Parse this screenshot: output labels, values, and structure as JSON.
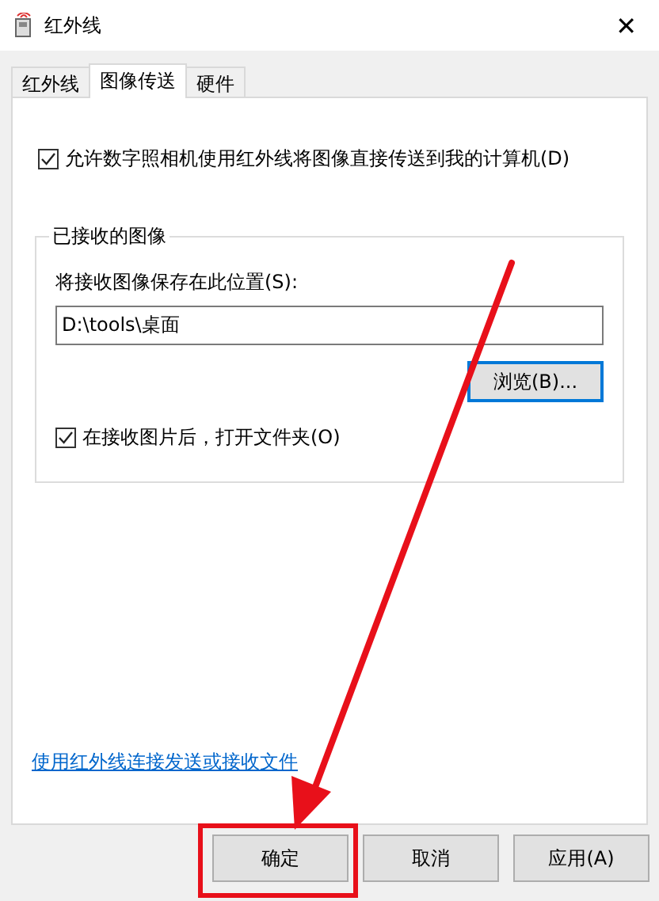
{
  "window": {
    "title": "红外线",
    "close": "✕"
  },
  "tabs": [
    {
      "label": "红外线",
      "selected": false
    },
    {
      "label": "图像传送",
      "selected": true
    },
    {
      "label": "硬件",
      "selected": false
    }
  ],
  "allow_checkbox": {
    "label": "允许数字照相机使用红外线将图像直接传送到我的计算机(D)",
    "checked": true
  },
  "received_group": {
    "title": "已接收的图像",
    "field_label": "将接收图像保存在此位置(S):",
    "path_value": "D:\\tools\\桌面",
    "browse_button": {
      "label": "浏览(B)...",
      "focused": true
    },
    "open_checkbox": {
      "label": "在接收图片后，打开文件夹(O)",
      "checked": true
    }
  },
  "link": "使用红外线连接发送或接收文件",
  "buttons": [
    {
      "label": "确定",
      "highlighted": true
    },
    {
      "label": "取消",
      "highlighted": false
    },
    {
      "label": "应用(A)",
      "highlighted": false
    }
  ]
}
